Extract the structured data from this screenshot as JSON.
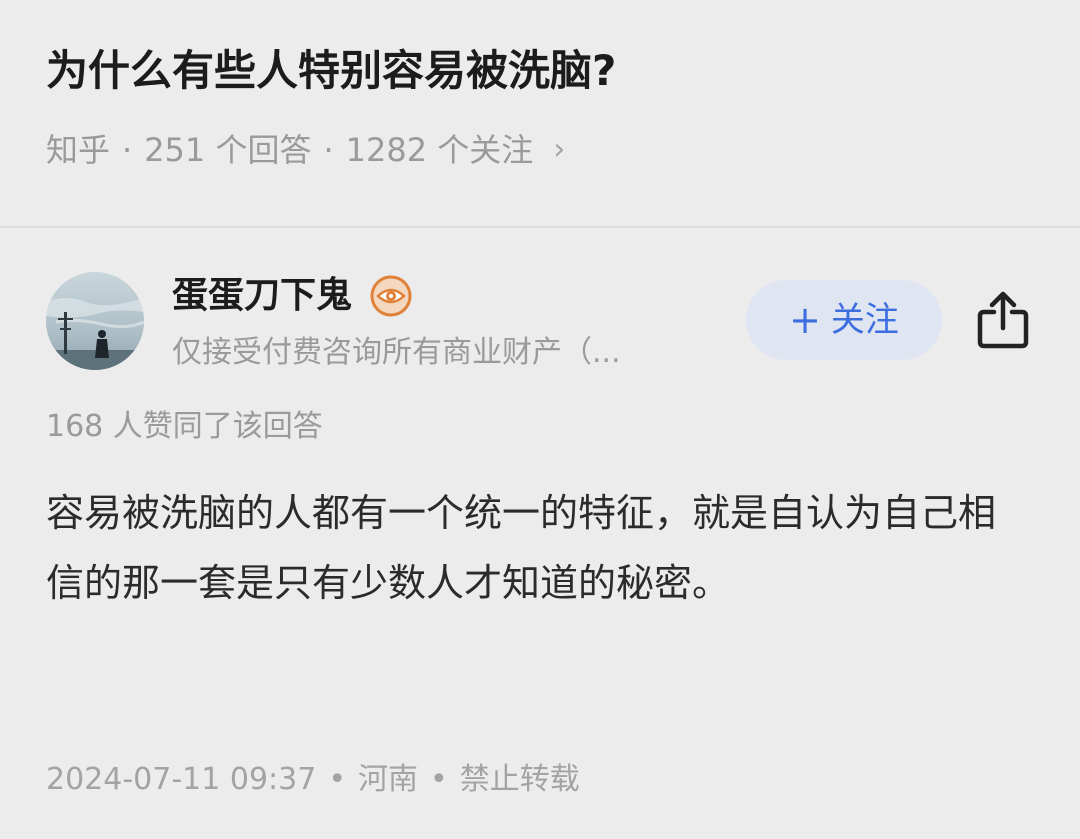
{
  "question": {
    "title": "为什么有些人特别容易被洗脑?",
    "source": "知乎",
    "answers_count": "251 个回答",
    "followers_count": "1282 个关注",
    "separator": "·",
    "chevron": "›"
  },
  "author": {
    "name": "蛋蛋刀下鬼",
    "badge_icon": "eye-badge-icon",
    "bio": "仅接受付费咨询所有商业财产（...",
    "follow_label": "关注",
    "follow_plus": "+",
    "share_icon": "share-icon"
  },
  "answer": {
    "votes": "168 人赞同了该回答",
    "content": "容易被洗脑的人都有一个统一的特征，就是自认为自己相信的那一套是只有少数人才知道的秘密。"
  },
  "footer": {
    "datetime": "2024-07-11 09:37",
    "location": "河南",
    "copyright": "禁止转载",
    "separator": "•"
  },
  "colors": {
    "background": "#ececec",
    "accent": "#3d6ee0",
    "follow_button_bg": "#dfe6f1",
    "secondary_text": "#9a9a9a",
    "badge": "#e0813a"
  }
}
